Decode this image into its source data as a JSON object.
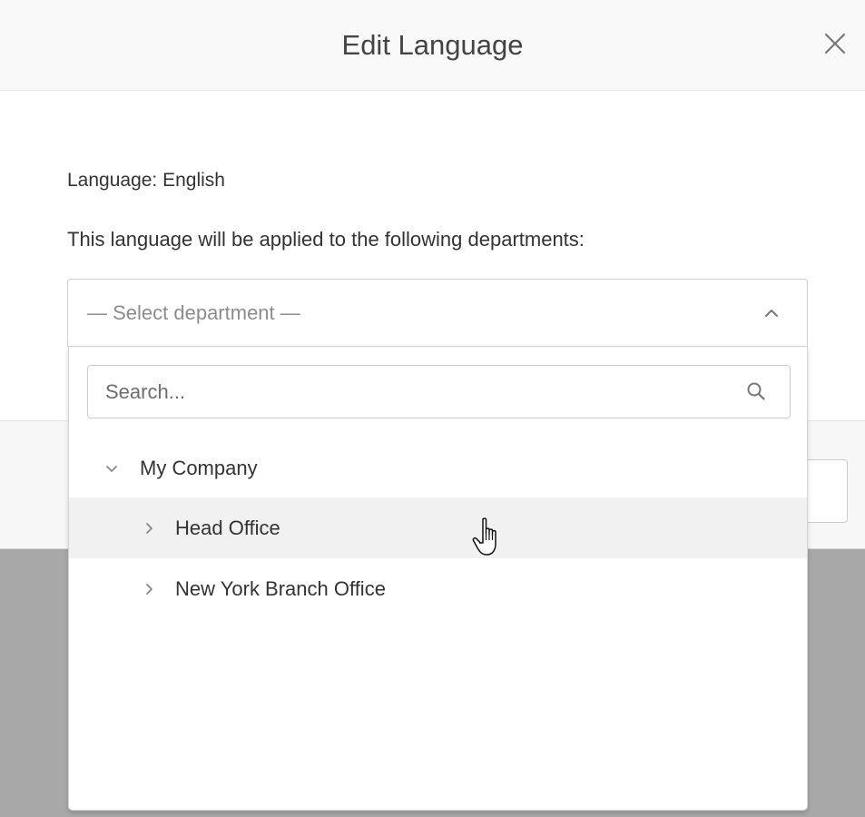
{
  "modal": {
    "title": "Edit Language",
    "close_icon": "close-icon",
    "language_label": "Language: English",
    "applied_text": "This language will be applied to the following departments:"
  },
  "department_select": {
    "placeholder": "— Select department —",
    "chevron_icon": "chevron-up-icon",
    "search": {
      "placeholder": "Search...",
      "value": "",
      "icon": "search-icon"
    },
    "tree": [
      {
        "label": "My Company",
        "expanded": true,
        "level": 0,
        "hovered": false
      },
      {
        "label": "Head Office",
        "expanded": false,
        "level": 1,
        "hovered": true
      },
      {
        "label": "New York Branch Office",
        "expanded": false,
        "level": 1,
        "hovered": false
      }
    ]
  },
  "colors": {
    "overlay": "#a8a8a8",
    "header_bg": "#f9f9f9",
    "hover_row": "#f1f1f1",
    "placeholder_text": "#8c8c8c"
  }
}
